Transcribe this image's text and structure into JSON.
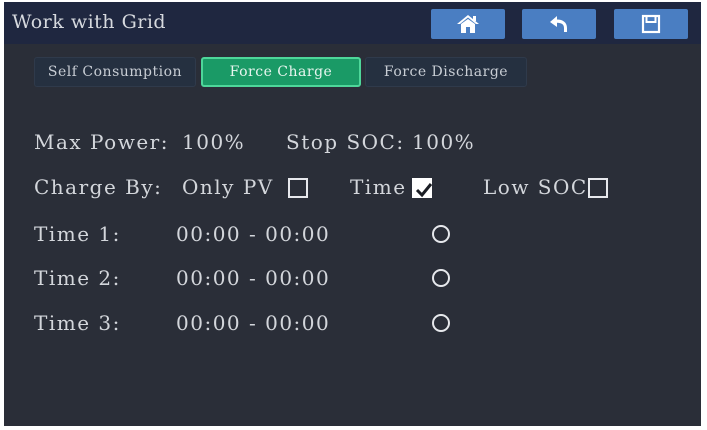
{
  "header": {
    "title": "Work with Grid",
    "buttons": [
      {
        "icon": "home-icon"
      },
      {
        "icon": "back-icon"
      },
      {
        "icon": "save-icon"
      }
    ],
    "accent": "#4a7ec2"
  },
  "tabs": [
    {
      "label": "Self Consumption",
      "active": false
    },
    {
      "label": "Force Charge",
      "active": true
    },
    {
      "label": "Force Discharge",
      "active": false
    }
  ],
  "settings": {
    "max_power_label": "Max Power:",
    "max_power_value": "100%",
    "stop_soc_label": "Stop SOC:",
    "stop_soc_value": "100%",
    "charge_by_label": "Charge By:",
    "options": [
      {
        "label": "Only PV",
        "checked": false
      },
      {
        "label": "Time",
        "checked": true
      },
      {
        "label": "Low SOC",
        "checked": false
      }
    ]
  },
  "times": [
    {
      "label": "Time 1:",
      "range": "00:00 - 00:00",
      "selected": false
    },
    {
      "label": "Time 2:",
      "range": "00:00 - 00:00",
      "selected": false
    },
    {
      "label": "Time 3:",
      "range": "00:00 - 00:00",
      "selected": false
    }
  ],
  "colors": {
    "background": "#2a2e38",
    "header": "#1f2740",
    "active_tab": "#1a9a66"
  }
}
